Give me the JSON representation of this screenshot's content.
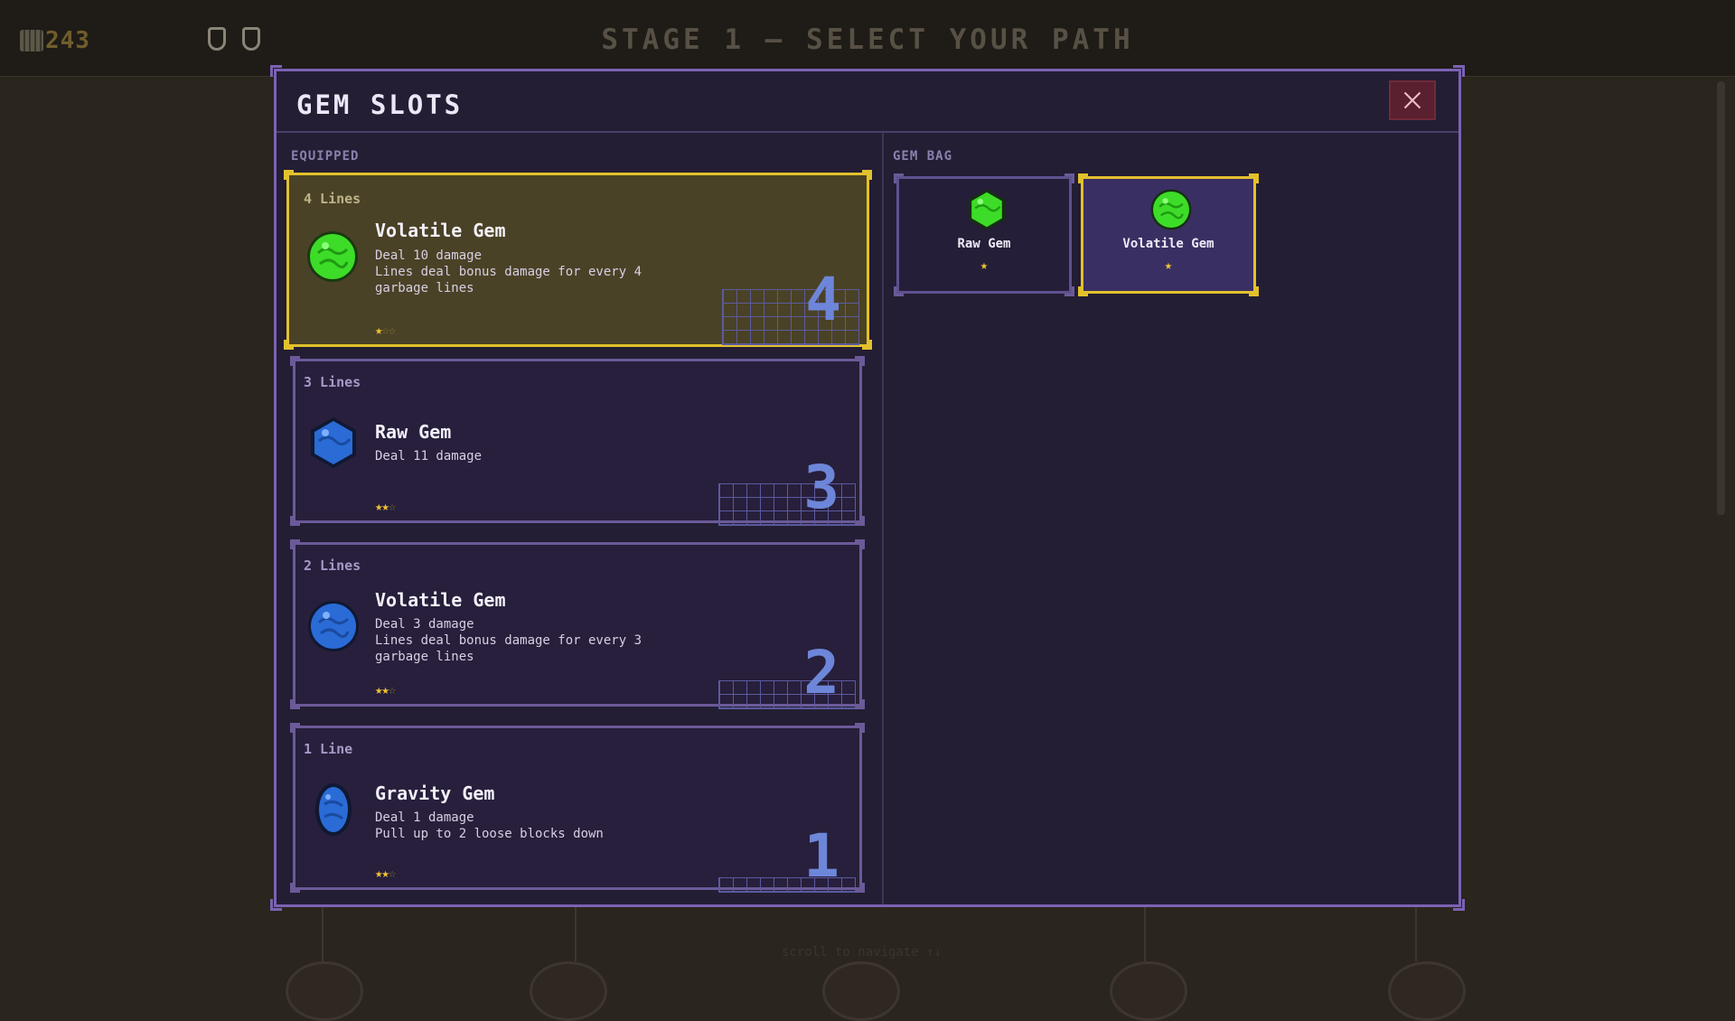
{
  "hud": {
    "coins": "243",
    "stage_title": "STAGE 1 — SELECT YOUR PATH",
    "scroll_hint": "scroll to navigate ↑↓"
  },
  "modal": {
    "title": "GEM SLOTS",
    "equipped_label": "EQUIPPED",
    "bag_label": "GEM BAG"
  },
  "slots": [
    {
      "lines": "4 Lines",
      "name": "Volatile Gem",
      "desc1": "Deal 10 damage",
      "desc2": "Lines deal bonus damage for every 4 garbage lines",
      "number": "4",
      "stars_on": "★",
      "stars_off": "☆☆",
      "gem": "green-round"
    },
    {
      "lines": "3 Lines",
      "name": "Raw Gem",
      "desc1": "Deal 11 damage",
      "desc2": "",
      "number": "3",
      "stars_on": "★★",
      "stars_off": "☆",
      "gem": "blue-hex"
    },
    {
      "lines": "2 Lines",
      "name": "Volatile Gem",
      "desc1": "Deal 3 damage",
      "desc2": "Lines deal bonus damage for every 3 garbage lines",
      "number": "2",
      "stars_on": "★★",
      "stars_off": "☆",
      "gem": "blue-round"
    },
    {
      "lines": "1 Line",
      "name": "Gravity Gem",
      "desc1": "Deal 1 damage",
      "desc2": "Pull up to 2 loose blocks down",
      "number": "1",
      "stars_on": "★★",
      "stars_off": "☆",
      "gem": "blue-oval"
    }
  ],
  "bag": [
    {
      "name": "Raw Gem",
      "stars": "★",
      "gem": "green-hex"
    },
    {
      "name": "Volatile Gem",
      "stars": "★",
      "gem": "green-round"
    }
  ],
  "colors": {
    "accent_gold": "#e2c12c",
    "frame_purple": "#7b62b4",
    "close_red": "#5a2030"
  }
}
